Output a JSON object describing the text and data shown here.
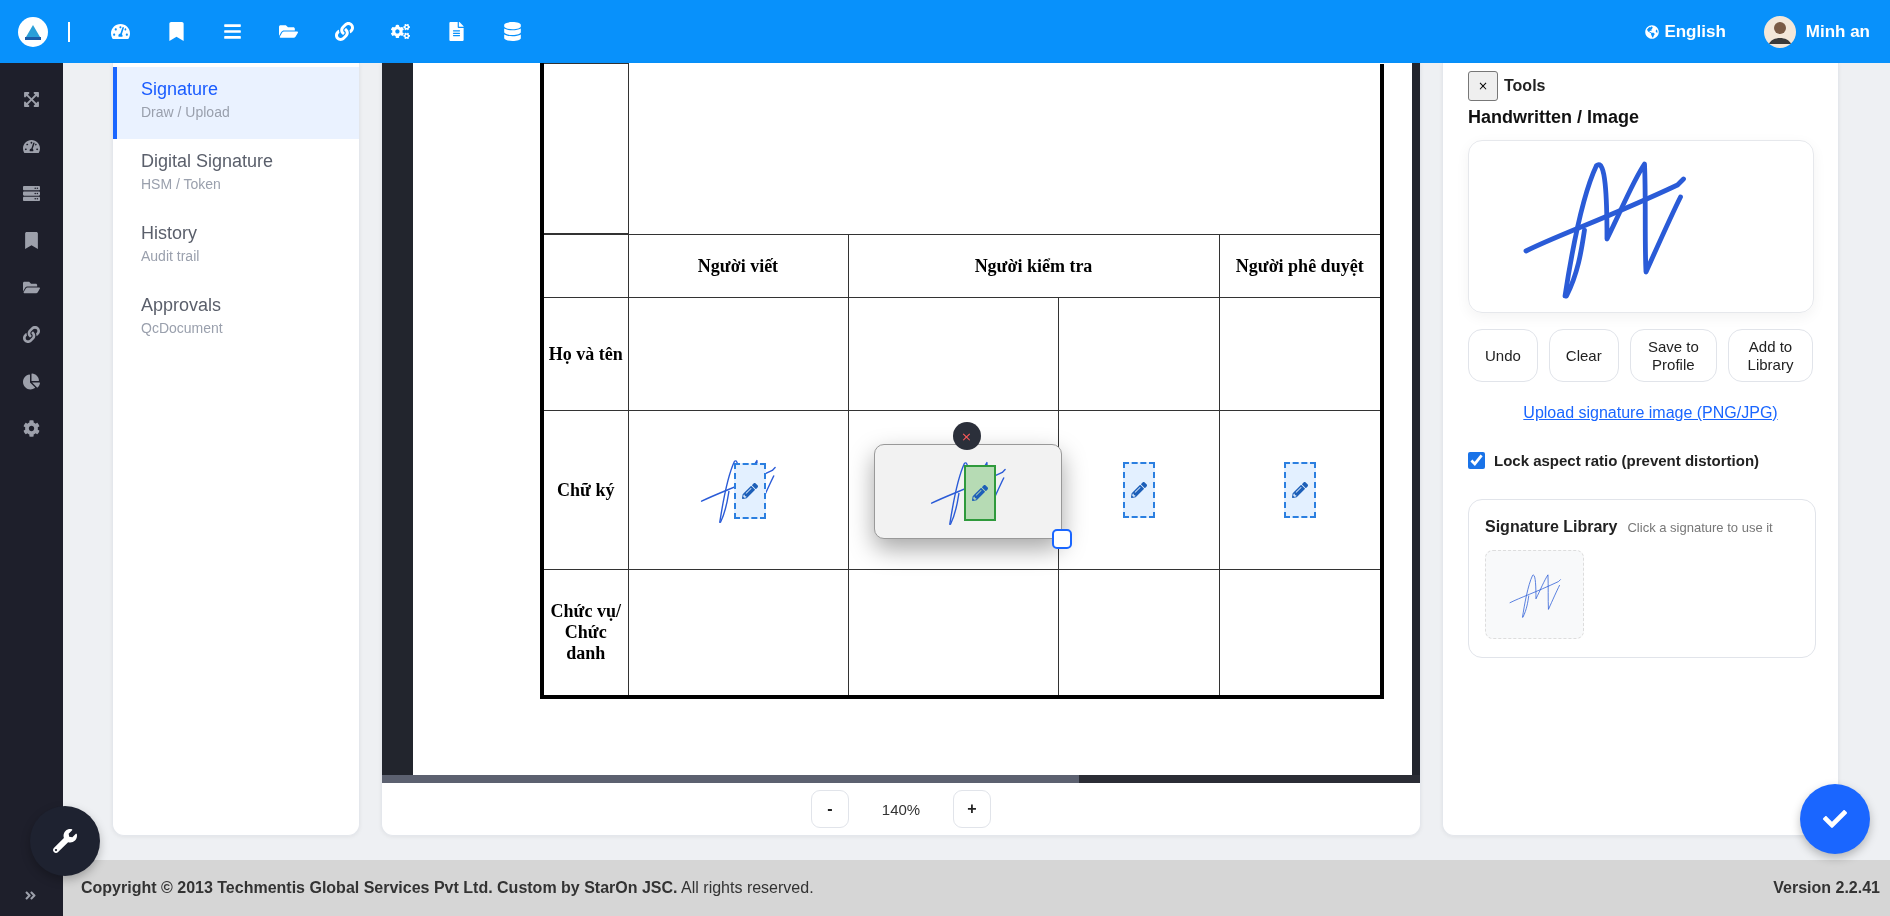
{
  "topbar": {
    "language": "English",
    "user": "Minh an"
  },
  "menu": [
    {
      "title": "Signature",
      "subtitle": "Draw / Upload",
      "selected": true
    },
    {
      "title": "Digital Signature",
      "subtitle": "HSM / Token",
      "selected": false
    },
    {
      "title": "History",
      "subtitle": "Audit trail",
      "selected": false
    },
    {
      "title": "Approvals",
      "subtitle": "QcDocument",
      "selected": false
    }
  ],
  "document": {
    "columns": [
      {
        "label": "Người viết",
        "signatures": [
          {
            "kind": "signed"
          }
        ]
      },
      {
        "label": "Người kiểm tra",
        "signatures": [
          {
            "kind": "placing",
            "close": "×"
          },
          {
            "kind": "empty"
          }
        ]
      },
      {
        "label": "Người phê duyệt",
        "signatures": [
          {
            "kind": "empty"
          }
        ]
      }
    ],
    "rows": [
      {
        "label": "Họ và tên",
        "kind": "blank"
      },
      {
        "label": "Chữ ký",
        "kind": "signature"
      },
      {
        "label": "Chức vụ/ Chức danh",
        "kind": "blank"
      }
    ]
  },
  "zoom": {
    "out": "-",
    "value": "140%",
    "in": "+"
  },
  "tools": {
    "close": "×",
    "title": "Tools",
    "heading": "Handwritten / Image",
    "buttons": [
      "Undo",
      "Clear",
      "Save to Profile",
      "Add to Library"
    ],
    "upload_link": "Upload signature image (PNG/JPG)",
    "lock_aspect": {
      "label": "Lock aspect ratio (prevent distortion)",
      "checked": true
    },
    "library": {
      "title": "Signature Library",
      "hint": "Click a signature to use it",
      "items": [
        {
          "kind": "signature"
        }
      ]
    }
  },
  "footer": {
    "copyright": "**Copyright © 2013 Techmentis Global Services Pvt Ltd. Custom by StarOn JSC.** All rights reserved.",
    "version": "Version 2.2.41"
  }
}
